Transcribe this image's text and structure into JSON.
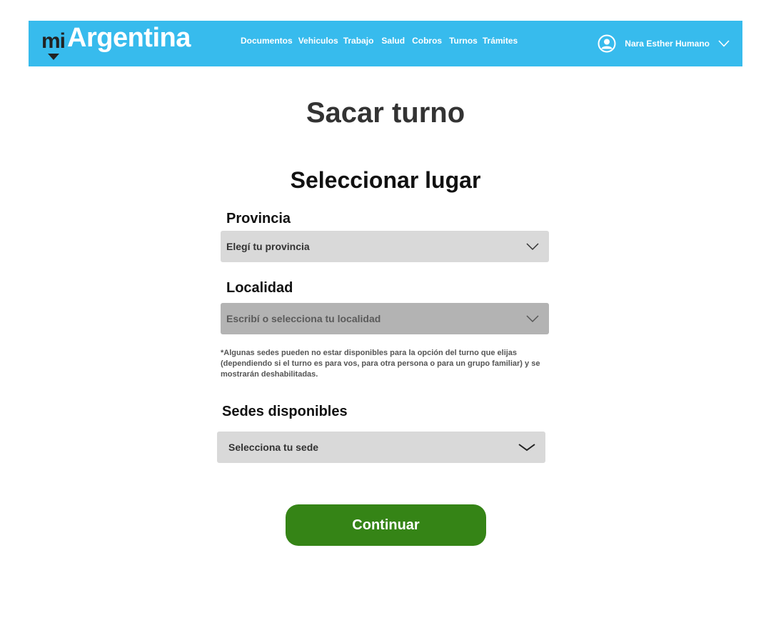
{
  "header": {
    "logo": {
      "mi": "mi",
      "name": "Argentina"
    },
    "nav": [
      {
        "label": "Documentos"
      },
      {
        "label": "Vehiculos"
      },
      {
        "label": "Trabajo"
      },
      {
        "label": "Salud"
      },
      {
        "label": "Cobros"
      },
      {
        "label": "Turnos"
      },
      {
        "label": "Trámites"
      }
    ],
    "user": {
      "name": "Nara Esther Humano",
      "avatar_icon": "user-circle-icon",
      "menu_icon": "chevron-down-icon"
    },
    "background": "#37bbed"
  },
  "page": {
    "title": "Sacar turno",
    "section_title": "Seleccionar lugar"
  },
  "form": {
    "provincia": {
      "label": "Provincia",
      "placeholder": "Elegí tu provincia"
    },
    "localidad": {
      "label": "Localidad",
      "placeholder": "Escribí o selecciona tu localidad",
      "disabled": true
    },
    "note": "*Algunas sedes pueden no estar disponibles para la opción del turno que elijas (dependiendo si el turno es para vos, para otra persona o para un grupo familiar) y se mostrarán deshabilitadas.",
    "sedes": {
      "label": "Sedes disponibles",
      "placeholder": "Selecciona tu sede"
    },
    "continue_label": "Continuar",
    "continue_color": "#358416"
  }
}
